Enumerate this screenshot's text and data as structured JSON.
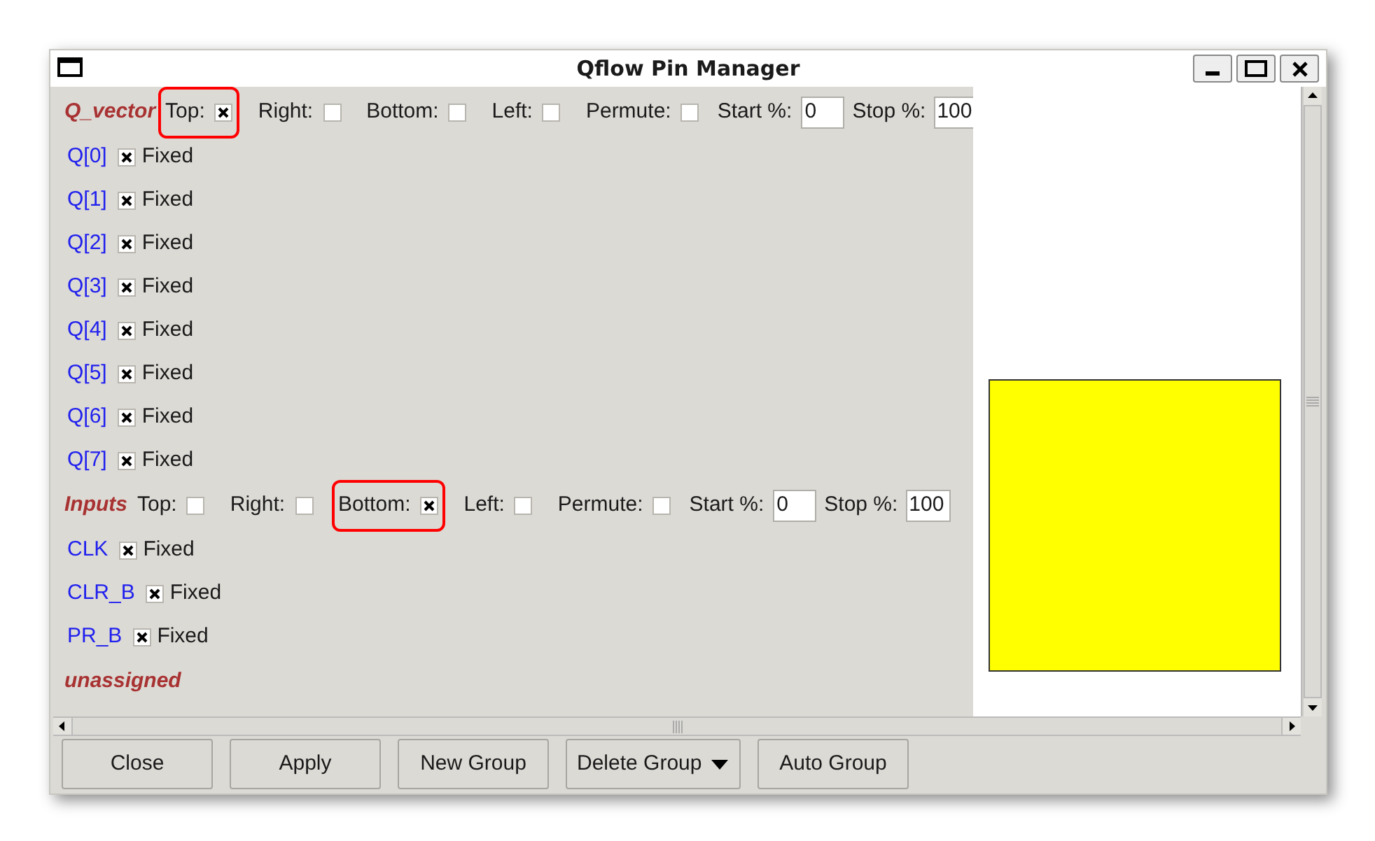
{
  "window": {
    "title": "Qflow Pin Manager"
  },
  "groups": [
    {
      "name": "Q_vector",
      "options": [
        {
          "label": "Top:",
          "checked": true,
          "highlighted": true
        },
        {
          "label": "Right:",
          "checked": false,
          "highlighted": false
        },
        {
          "label": "Bottom:",
          "checked": false,
          "highlighted": false
        },
        {
          "label": "Left:",
          "checked": false,
          "highlighted": false
        },
        {
          "label": "Permute:",
          "checked": false,
          "highlighted": false
        }
      ],
      "start_label": "Start %:",
      "start_value": "0",
      "stop_label": "Stop %:",
      "stop_value": "100",
      "pins": [
        {
          "name": "Q[0]",
          "label": "Fixed",
          "fixed": true
        },
        {
          "name": "Q[1]",
          "label": "Fixed",
          "fixed": true
        },
        {
          "name": "Q[2]",
          "label": "Fixed",
          "fixed": true
        },
        {
          "name": "Q[3]",
          "label": "Fixed",
          "fixed": true
        },
        {
          "name": "Q[4]",
          "label": "Fixed",
          "fixed": true
        },
        {
          "name": "Q[5]",
          "label": "Fixed",
          "fixed": true
        },
        {
          "name": "Q[6]",
          "label": "Fixed",
          "fixed": true
        },
        {
          "name": "Q[7]",
          "label": "Fixed",
          "fixed": true
        }
      ]
    },
    {
      "name": "Inputs",
      "options": [
        {
          "label": "Top:",
          "checked": false,
          "highlighted": false
        },
        {
          "label": "Right:",
          "checked": false,
          "highlighted": false
        },
        {
          "label": "Bottom:",
          "checked": true,
          "highlighted": true
        },
        {
          "label": "Left:",
          "checked": false,
          "highlighted": false
        },
        {
          "label": "Permute:",
          "checked": false,
          "highlighted": false
        }
      ],
      "start_label": "Start %:",
      "start_value": "0",
      "stop_label": "Stop %:",
      "stop_value": "100",
      "pins": [
        {
          "name": "CLK",
          "label": "Fixed",
          "fixed": true
        },
        {
          "name": "CLR_B",
          "label": "Fixed",
          "fixed": true
        },
        {
          "name": "PR_B",
          "label": "Fixed",
          "fixed": true
        }
      ]
    }
  ],
  "unassigned_label": "unassigned",
  "buttons": [
    {
      "label": "Close",
      "kind": "plain"
    },
    {
      "label": "Apply",
      "kind": "plain"
    },
    {
      "label": "New Group",
      "kind": "plain"
    },
    {
      "label": "Delete Group",
      "kind": "dropdown"
    },
    {
      "label": "Auto Group",
      "kind": "plain"
    }
  ]
}
